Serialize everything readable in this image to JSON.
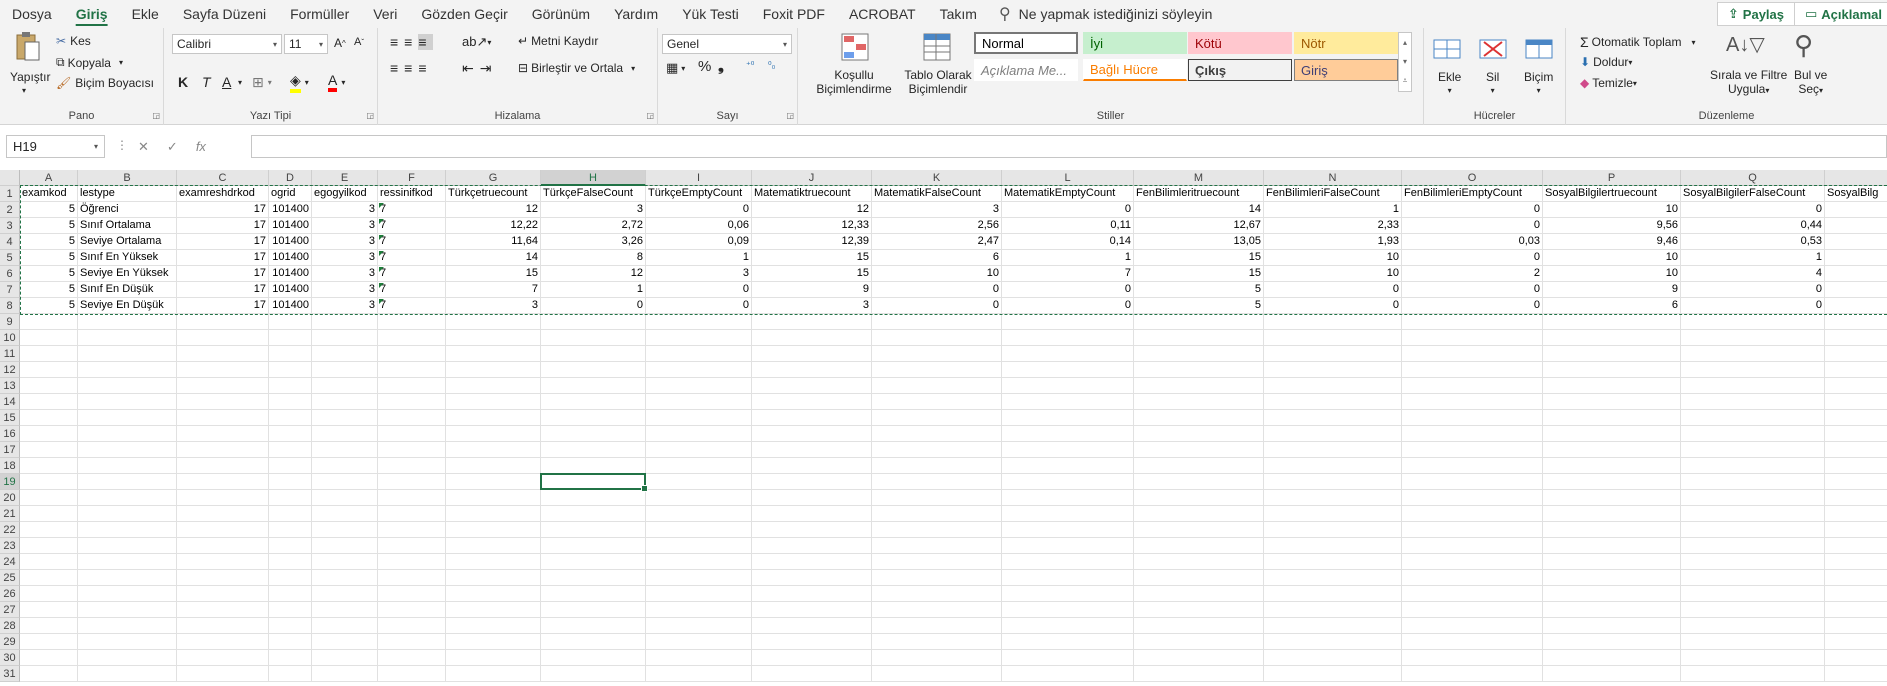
{
  "menu": {
    "tabs": [
      "Dosya",
      "Giriş",
      "Ekle",
      "Sayfa Düzeni",
      "Formüller",
      "Veri",
      "Gözden Geçir",
      "Görünüm",
      "Yardım",
      "Yük Testi",
      "Foxit PDF",
      "ACROBAT",
      "Takım"
    ],
    "active_tab": "Giriş",
    "tell_me": "Ne yapmak istediğinizi söyleyin",
    "share": "Paylaş",
    "comments": "Açıklamal"
  },
  "ribbon": {
    "clipboard": {
      "label": "Pano",
      "paste": "Yapıştır",
      "cut": "Kes",
      "copy": "Kopyala",
      "format_painter": "Biçim Boyacısı"
    },
    "font": {
      "label": "Yazı Tipi",
      "font_name": "Calibri",
      "font_size": "11",
      "bold": "K",
      "italic": "T",
      "underline": "A"
    },
    "alignment": {
      "label": "Hizalama",
      "wrap": "Metni Kaydır",
      "merge": "Birleştir ve Ortala"
    },
    "number": {
      "label": "Sayı",
      "format": "Genel"
    },
    "styles": {
      "label": "Stiller",
      "conditional_1": "Koşullu",
      "conditional_2": "Biçimlendirme",
      "table_1": "Tablo Olarak",
      "table_2": "Biçimlendir",
      "items": [
        {
          "name": "Normal",
          "bg": "#ffffff",
          "fg": "#000000"
        },
        {
          "name": "İyi",
          "bg": "#c6efce",
          "fg": "#006100"
        },
        {
          "name": "Kötü",
          "bg": "#ffc7ce",
          "fg": "#9c0006"
        },
        {
          "name": "Nötr",
          "bg": "#ffeb9c",
          "fg": "#9c5700"
        },
        {
          "name": "Açıklama Me...",
          "bg": "#ffffff",
          "fg": "#7f7f7f"
        },
        {
          "name": "Bağlı Hücre",
          "bg": "#ffffff",
          "fg": "#fa7d00"
        },
        {
          "name": "Çıkış",
          "bg": "#f2f2f2",
          "fg": "#3f3f3f"
        },
        {
          "name": "Giriş",
          "bg": "#ffcc99",
          "fg": "#3f3f76"
        }
      ]
    },
    "cells": {
      "label": "Hücreler",
      "insert": "Ekle",
      "delete": "Sil",
      "format": "Biçim"
    },
    "editing": {
      "label": "Düzenleme",
      "autosum": "Otomatik Toplam",
      "fill": "Doldur",
      "clear": "Temizle",
      "sort_1": "Sırala ve Filtre",
      "sort_2": "Uygula",
      "find_1": "Bul ve",
      "find_2": "Seç"
    }
  },
  "formula_bar": {
    "name_box": "H19",
    "formula": ""
  },
  "sheet": {
    "columns": [
      "A",
      "B",
      "C",
      "D",
      "E",
      "F",
      "G",
      "H",
      "I",
      "J",
      "K",
      "L",
      "M",
      "N",
      "O",
      "P",
      "Q",
      ""
    ],
    "selected_column": "H",
    "selected_row": 19,
    "row_count": 31,
    "rows": [
      [
        "examkod",
        "lestype",
        "examreshdrkod",
        "ogrid",
        "egogyilkod",
        "ressinifkod",
        "Türkçetruecount",
        "TürkçeFalseCount",
        "TürkçeEmptyCount",
        "Matematiktruecount",
        "MatematikFalseCount",
        "MatematikEmptyCount",
        "FenBilimleritruecount",
        "FenBilimleriFalseCount",
        "FenBilimleriEmptyCount",
        "SosyalBilgilertruecount",
        "SosyalBilgilerFalseCount",
        "SosyalBilg"
      ],
      [
        "5",
        "Öğrenci",
        "17",
        "101400",
        "3",
        "7",
        "12",
        "3",
        "0",
        "12",
        "3",
        "0",
        "14",
        "1",
        "0",
        "10",
        "0",
        ""
      ],
      [
        "5",
        "Sınıf Ortalama",
        "17",
        "101400",
        "3",
        "7",
        "12,22",
        "2,72",
        "0,06",
        "12,33",
        "2,56",
        "0,11",
        "12,67",
        "2,33",
        "0",
        "9,56",
        "0,44",
        ""
      ],
      [
        "5",
        "Seviye Ortalama",
        "17",
        "101400",
        "3",
        "7",
        "11,64",
        "3,26",
        "0,09",
        "12,39",
        "2,47",
        "0,14",
        "13,05",
        "1,93",
        "0,03",
        "9,46",
        "0,53",
        ""
      ],
      [
        "5",
        "Sınıf En Yüksek",
        "17",
        "101400",
        "3",
        "7",
        "14",
        "8",
        "1",
        "15",
        "6",
        "1",
        "15",
        "10",
        "0",
        "10",
        "1",
        ""
      ],
      [
        "5",
        "Seviye En Yüksek",
        "17",
        "101400",
        "3",
        "7",
        "15",
        "12",
        "3",
        "15",
        "10",
        "7",
        "15",
        "10",
        "2",
        "10",
        "4",
        ""
      ],
      [
        "5",
        "Sınıf En Düşük",
        "17",
        "101400",
        "3",
        "7",
        "7",
        "1",
        "0",
        "9",
        "0",
        "0",
        "5",
        "0",
        "0",
        "9",
        "0",
        ""
      ],
      [
        "5",
        "Seviye En Düşük",
        "17",
        "101400",
        "3",
        "7",
        "3",
        "0",
        "0",
        "3",
        "0",
        "0",
        "5",
        "0",
        "0",
        "6",
        "0",
        ""
      ]
    ]
  }
}
